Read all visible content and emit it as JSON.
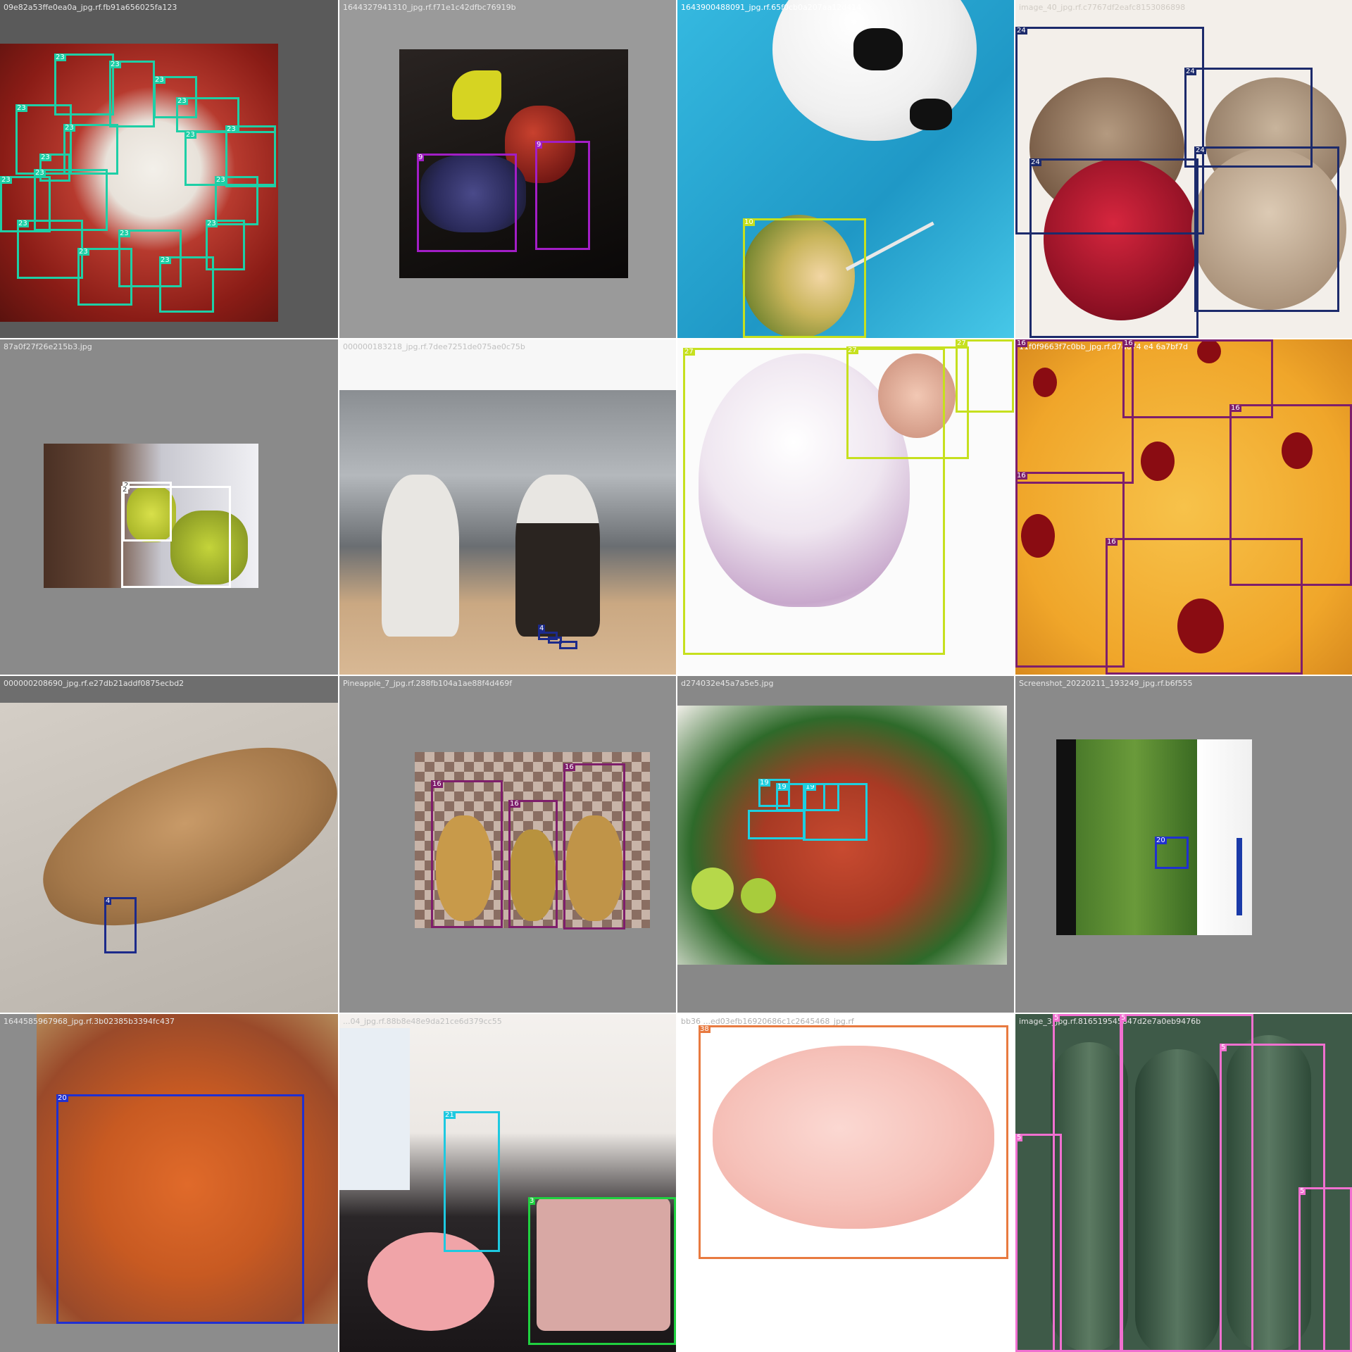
{
  "colors": {
    "class_23": "#1ecfa6",
    "class_9": "#a21ec6",
    "class_10": "#c6e01e",
    "class_24": "#1c2a6b",
    "class_2": "#ffffff",
    "class_4": "#1c2a8a",
    "class_27": "#c6e01e",
    "class_16": "#7e1e6b",
    "class_20": "#2030d0",
    "class_19": "#1ecfe0",
    "class_21": "#1ec9e0",
    "class_3": "#20d040",
    "class_38": "#e87a40",
    "class_5": "#f070d0"
  },
  "tiles": [
    {
      "filename": "09e82a53ffe0ea0a_jpg.rf.fb91a656025fa123",
      "bg": "#5a5a5a",
      "photo_desc_colors": [
        "#7a1a14",
        "#c43628",
        "#f0eee9"
      ],
      "boxes": [
        {
          "label": "23"
        },
        {
          "label": "23"
        },
        {
          "label": "23"
        },
        {
          "label": "23"
        },
        {
          "label": "23"
        },
        {
          "label": "23"
        },
        {
          "label": "23"
        },
        {
          "label": "23"
        },
        {
          "label": "23"
        },
        {
          "label": "23"
        },
        {
          "label": "23"
        },
        {
          "label": "23"
        },
        {
          "label": "23"
        },
        {
          "label": "23"
        },
        {
          "label": "23"
        },
        {
          "label": "23"
        },
        {
          "label": "23"
        }
      ]
    },
    {
      "filename": "1644327941310_jpg.rf.f71e1c42dfbc76919b",
      "bg": "#9a9a9a",
      "boxes": [
        {
          "label": "9"
        },
        {
          "label": "9"
        }
      ]
    },
    {
      "filename": "1643900488091_jpg.rf.65f0cb0a207aa12d414",
      "bg": "#2fb0d8",
      "boxes": [
        {
          "label": "10"
        }
      ]
    },
    {
      "filename": "image_40_jpg.rf.c7767df2eafc8153086898",
      "bg": "#f3efea",
      "boxes": [
        {
          "label": "24"
        },
        {
          "label": "24"
        },
        {
          "label": "24"
        },
        {
          "label": "24"
        }
      ]
    },
    {
      "filename": "87a0f27f26e215b3.jpg",
      "bg": "#8a8a8a",
      "boxes": [
        {
          "label": "2"
        },
        {
          "label": "2"
        }
      ]
    },
    {
      "filename": "000000183218_jpg.rf.7dee7251de075ae0c75b",
      "bg": "#f7f7f7",
      "boxes": [
        {
          "label": "4"
        },
        {
          "label": ""
        },
        {
          "label": ""
        }
      ]
    },
    {
      "filename": "",
      "bg": "#fbfbfb",
      "boxes": [
        {
          "label": "27"
        },
        {
          "label": "27"
        },
        {
          "label": "27"
        }
      ]
    },
    {
      "filename": "11f0f9663f7c0bb_jpg.rf.d7d074 e4 6a7bf7d",
      "bg": "#f2ad2c",
      "boxes": [
        {
          "label": "16"
        },
        {
          "label": "16"
        },
        {
          "label": "16"
        },
        {
          "label": "16"
        },
        {
          "label": "16"
        }
      ]
    },
    {
      "filename": "000000208690_jpg.rf.e27db21addf0875ecbd2",
      "bg": "#c8c2ba",
      "boxes": [
        {
          "label": "4"
        }
      ]
    },
    {
      "filename": "Pineapple_7_jpg.rf.288fb104a1ae88f4d469f",
      "bg": "#8e8e8e",
      "boxes": [
        {
          "label": "16"
        },
        {
          "label": "16"
        },
        {
          "label": "16"
        }
      ]
    },
    {
      "filename": "d274032e45a7a5e5.jpg",
      "bg": "#888888",
      "boxes": [
        {
          "label": "19"
        },
        {
          "label": "19"
        },
        {
          "label": "19"
        },
        {
          "label": ""
        },
        {
          "label": ""
        }
      ]
    },
    {
      "filename": "Screenshot_20220211_193249_jpg.rf.b6f555",
      "bg": "#8a8a8a",
      "boxes": [
        {
          "label": "20"
        }
      ]
    },
    {
      "filename": "1644585967968_jpg.rf.3b02385b3394fc437",
      "bg": "#8c8c8c",
      "boxes": [
        {
          "label": "20"
        }
      ]
    },
    {
      "filename": "...04_jpg.rf.88b8e48e9da21ce6d379cc55",
      "bg": "#f4f1ee",
      "boxes": [
        {
          "label": "21"
        },
        {
          "label": "3"
        }
      ]
    },
    {
      "filename": "bb36 ...ed03efb16920686c1c2645468_jpg.rf",
      "bg": "#ffffff",
      "boxes": [
        {
          "label": "38"
        }
      ]
    },
    {
      "filename": "image_3_jpg.rf.816519545847d2e7a0eb9476b",
      "bg": "#3e5a48",
      "boxes": [
        {
          "label": "5"
        },
        {
          "label": "5"
        },
        {
          "label": "5"
        },
        {
          "label": "5"
        },
        {
          "label": "5"
        }
      ]
    }
  ]
}
